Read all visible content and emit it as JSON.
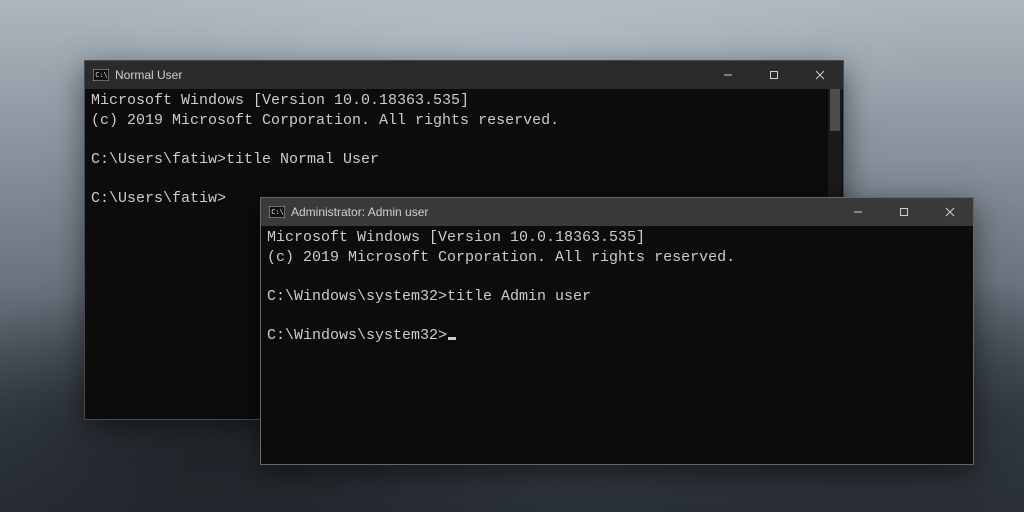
{
  "windows": {
    "back": {
      "title": "Normal User",
      "lines": {
        "l1": "Microsoft Windows [Version 10.0.18363.535]",
        "l2": "(c) 2019 Microsoft Corporation. All rights reserved.",
        "l3": "C:\\Users\\fatiw>title Normal User",
        "l4": "C:\\Users\\fatiw>"
      }
    },
    "front": {
      "title": "Administrator:  Admin user",
      "lines": {
        "l1": "Microsoft Windows [Version 10.0.18363.535]",
        "l2": "(c) 2019 Microsoft Corporation. All rights reserved.",
        "l3": "C:\\Windows\\system32>title Admin user",
        "l4": "C:\\Windows\\system32>"
      }
    }
  },
  "icons": {
    "cmd": "cmd-icon",
    "minimize": "minimize-icon",
    "maximize": "maximize-icon",
    "close": "close-icon"
  }
}
